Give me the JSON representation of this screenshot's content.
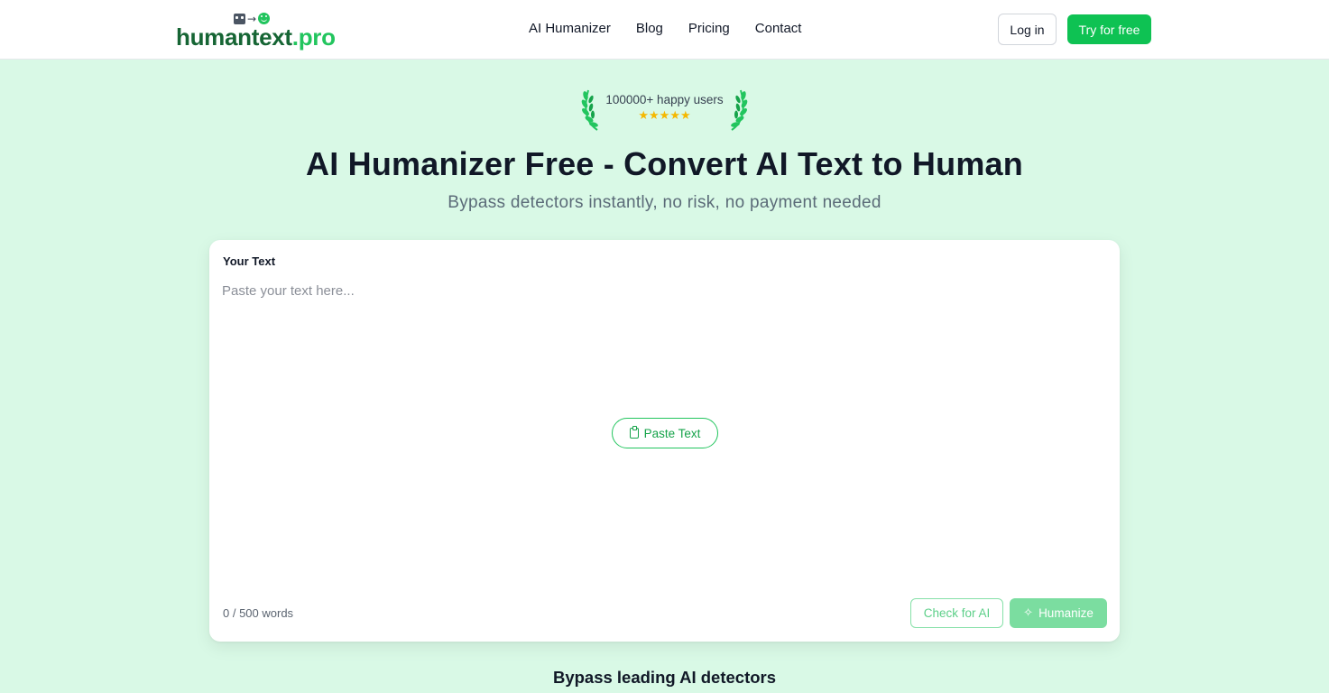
{
  "header": {
    "logo": {
      "part1": "human",
      "part2": "text",
      "part3": ".pro"
    },
    "nav": [
      "AI Humanizer",
      "Blog",
      "Pricing",
      "Contact"
    ],
    "login_label": "Log in",
    "try_label": "Try for free"
  },
  "hero": {
    "badge_text": "100000+ happy users",
    "stars": "★★★★★",
    "rating": 5,
    "title": "AI Humanizer Free - Convert AI Text to Human",
    "subtitle": "Bypass detectors instantly, no risk, no payment needed"
  },
  "editor": {
    "label": "Your Text",
    "placeholder": "Paste your text here...",
    "paste_label": "Paste Text",
    "word_count": "0 / 500 words",
    "check_label": "Check for AI",
    "humanize_label": "Humanize"
  },
  "section": {
    "title": "Bypass leading AI detectors"
  },
  "colors": {
    "brand_green": "#0ec253",
    "logo_dark": "#166534",
    "logo_light": "#22c55e",
    "background": "#d9f9e6",
    "star": "#f5b800"
  }
}
